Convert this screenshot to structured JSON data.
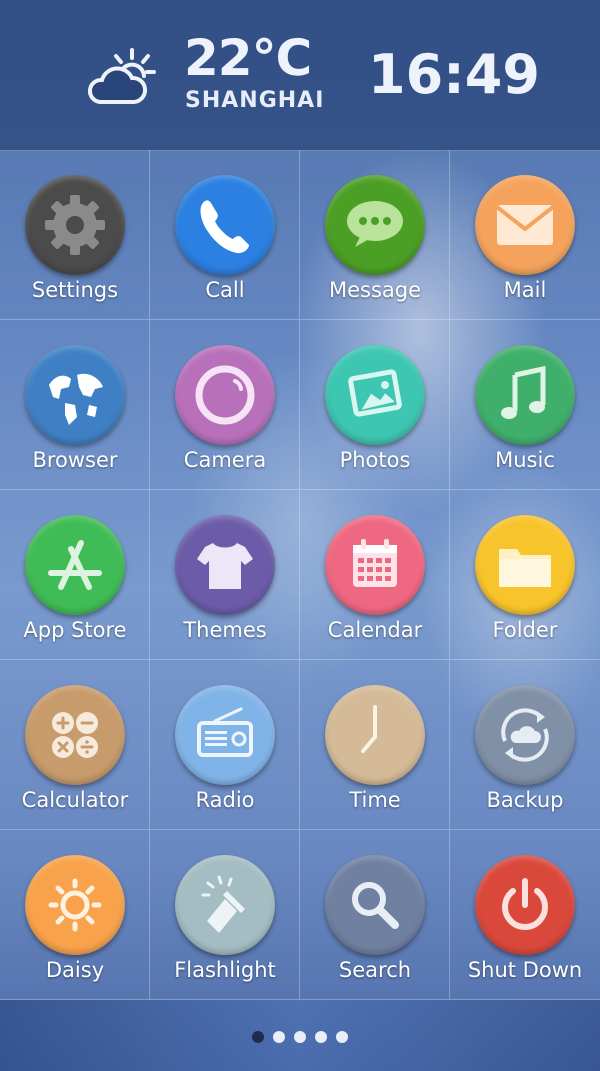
{
  "status": {
    "temperature": "22℃",
    "city": "SHANGHAI",
    "time": "16:49",
    "weather_icon": "partly-cloudy-icon"
  },
  "apps": [
    {
      "label": "Settings",
      "icon": "gear-icon",
      "color": "#4a4a4a"
    },
    {
      "label": "Call",
      "icon": "phone-icon",
      "color": "#2a7fe0"
    },
    {
      "label": "Message",
      "icon": "chat-bubble-icon",
      "color": "#4a9e23"
    },
    {
      "label": "Mail",
      "icon": "envelope-icon",
      "color": "#f4a05a"
    },
    {
      "label": "Browser",
      "icon": "globe-icon",
      "color": "#3d7fc4"
    },
    {
      "label": "Camera",
      "icon": "camera-lens-icon",
      "color": "#b76fb9"
    },
    {
      "label": "Photos",
      "icon": "photos-icon",
      "color": "#3cc5b0"
    },
    {
      "label": "Music",
      "icon": "music-note-icon",
      "color": "#3fae6a"
    },
    {
      "label": "App Store",
      "icon": "app-store-icon",
      "color": "#3fbb55"
    },
    {
      "label": "Themes",
      "icon": "tshirt-icon",
      "color": "#6a5aa8"
    },
    {
      "label": "Calendar",
      "icon": "calendar-icon",
      "color": "#ee6680"
    },
    {
      "label": "Folder",
      "icon": "folder-icon",
      "color": "#f7c32a"
    },
    {
      "label": "Calculator",
      "icon": "calculator-icon",
      "color": "#c69a6a"
    },
    {
      "label": "Radio",
      "icon": "radio-icon",
      "color": "#7fb2e6"
    },
    {
      "label": "Time",
      "icon": "clock-icon",
      "color": "#d3b996"
    },
    {
      "label": "Backup",
      "icon": "cloud-sync-icon",
      "color": "#7f8fa6"
    },
    {
      "label": "Daisy",
      "icon": "sun-icon",
      "color": "#f7a04a"
    },
    {
      "label": "Flashlight",
      "icon": "flashlight-icon",
      "color": "#a2bcc1"
    },
    {
      "label": "Search",
      "icon": "magnifier-icon",
      "color": "#6f7fa0"
    },
    {
      "label": "Shut Down",
      "icon": "power-icon",
      "color": "#d9473b"
    }
  ],
  "pager": {
    "pages": 5,
    "current": 1
  }
}
